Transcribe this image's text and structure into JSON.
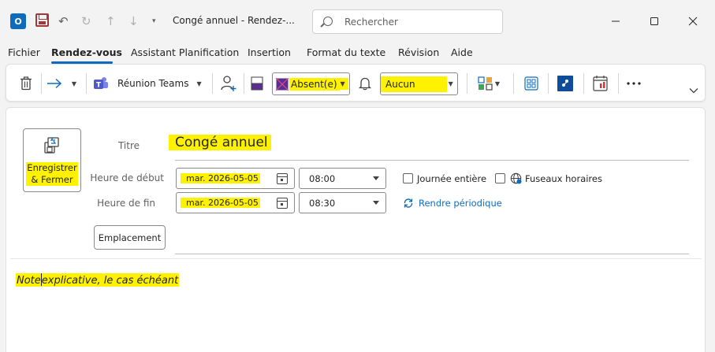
{
  "window": {
    "title": "Congé annuel  -  Rendez-...",
    "search_placeholder": "Rechercher"
  },
  "menu": {
    "items": [
      "Fichier",
      "Rendez-vous",
      "Assistant Planification",
      "Insertion",
      "Format du texte",
      "Révision",
      "Aide"
    ],
    "active": "Rendez-vous"
  },
  "ribbon": {
    "teams_label": "Réunion Teams",
    "show_as_value": "Absent(e)",
    "reminder_value": "Aucun"
  },
  "form": {
    "save_close_line1": "Enregistrer",
    "save_close_line2": "& Fermer",
    "title_label": "Titre",
    "title_value": "Congé annuel",
    "start_label": "Heure de début",
    "start_date": "mar. 2026-05-05",
    "start_time": "08:00",
    "end_label": "Heure de fin",
    "end_date": "mar. 2026-05-05",
    "end_time": "08:30",
    "all_day_label": "Journée entière",
    "all_day_checked": false,
    "timezones_label": "Fuseaux horaires",
    "timezones_checked": false,
    "recurrence_label": "Rendre périodique",
    "location_button": "Emplacement",
    "location_value": "",
    "note_part1": "Note",
    "note_part2": "explicative, le cas échéant"
  },
  "colors": {
    "accent": "#0f6cbd",
    "highlight": "#fff200",
    "show_as_purple": "#5c2e91"
  }
}
